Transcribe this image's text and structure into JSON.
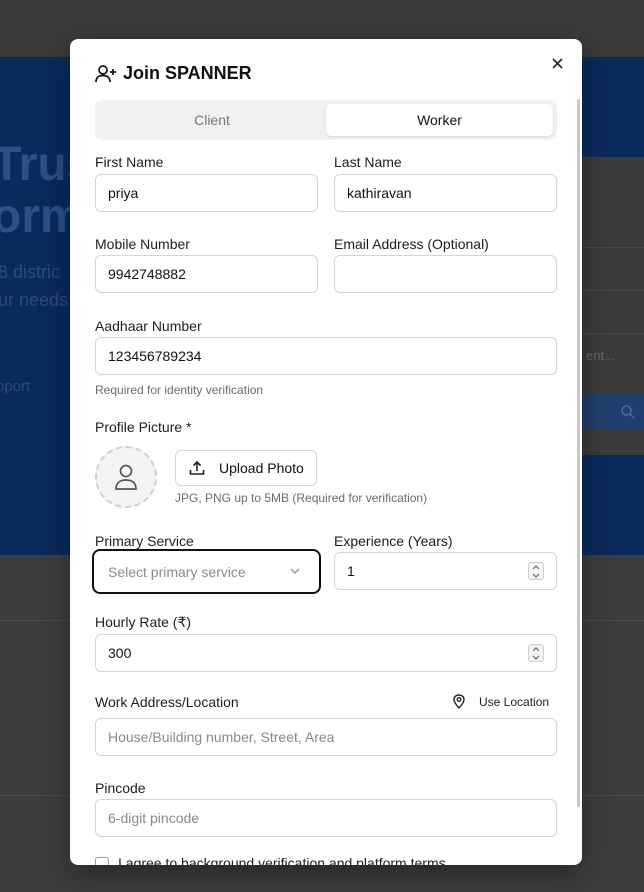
{
  "background": {
    "hero_title_1": "Trus",
    "hero_title_2": "orm",
    "hero_sub_1": "8 distric",
    "hero_sub_2": "ur needs",
    "hero_link": "pport",
    "card_placeholder": "ent..."
  },
  "modal": {
    "title": "Join SPANNER",
    "tabs": [
      {
        "label": "Client"
      },
      {
        "label": "Worker"
      }
    ],
    "first_name": {
      "label": "First Name",
      "value": "priya"
    },
    "last_name": {
      "label": "Last Name",
      "value": "kathiravan"
    },
    "mobile": {
      "label": "Mobile Number",
      "value": "9942748882"
    },
    "email": {
      "label": "Email Address (Optional)",
      "value": ""
    },
    "aadhaar": {
      "label": "Aadhaar Number",
      "value": "123456789234",
      "hint": "Required for identity verification"
    },
    "profile_picture": {
      "label": "Profile Picture *",
      "button": "Upload Photo",
      "hint": "JPG, PNG up to 5MB (Required for verification)"
    },
    "primary_service": {
      "label": "Primary Service",
      "placeholder": "Select primary service"
    },
    "experience": {
      "label": "Experience (Years)",
      "value": "1"
    },
    "hourly_rate": {
      "label": "Hourly Rate (₹)",
      "value": "300"
    },
    "work_address": {
      "label": "Work Address/Location",
      "use_location": "Use Location",
      "placeholder": "House/Building number, Street, Area"
    },
    "pincode": {
      "label": "Pincode",
      "placeholder": "6-digit pincode"
    },
    "agreement": {
      "label": "I agree to background verification and platform terms"
    }
  }
}
